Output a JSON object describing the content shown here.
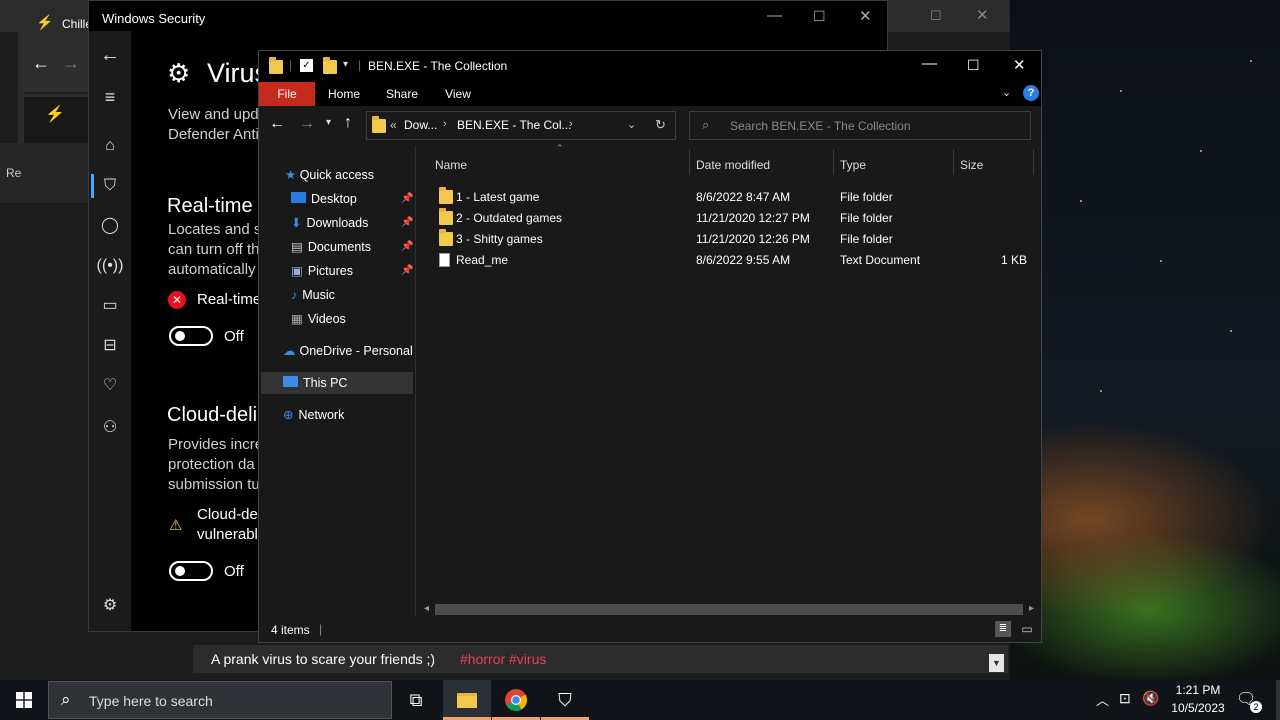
{
  "back_window": {
    "title": "Chille",
    "side_label": "Re"
  },
  "windows_security": {
    "title": "Windows Security",
    "page_title": "Virus",
    "intro_line1": "View and upd",
    "intro_line2": "Defender Anti",
    "realtime": {
      "heading": "Real-time",
      "desc1": "Locates and s",
      "desc2": "can turn off th",
      "desc3": "automatically",
      "warning": "Real-time",
      "toggle_label": "Off"
    },
    "cloud": {
      "heading": "Cloud-deli",
      "desc1": "Provides incre",
      "desc2": "protection da",
      "desc3": "submission tu",
      "warning1": "Cloud-de",
      "warning2": "vulnerabl",
      "toggle_label": "Off"
    }
  },
  "explorer": {
    "title": "BEN.EXE - The Collection",
    "ribbon": {
      "tabs": [
        "File",
        "Home",
        "Share",
        "View"
      ],
      "active_color": "#c42b1c"
    },
    "address": {
      "crumb1": "Dow...",
      "crumb2": "BEN.EXE - The Col...",
      "overflow": "«"
    },
    "search": {
      "placeholder": "Search BEN.EXE - The Collection"
    },
    "nav_pane": {
      "quick_access": "Quick access",
      "items": [
        "Desktop",
        "Downloads",
        "Documents",
        "Pictures",
        "Music",
        "Videos"
      ],
      "onedrive": "OneDrive - Personal",
      "this_pc": "This PC",
      "network": "Network"
    },
    "columns": {
      "name": "Name",
      "date": "Date modified",
      "type": "Type",
      "size": "Size"
    },
    "files": [
      {
        "name": "1 - Latest game",
        "date": "8/6/2022 8:47 AM",
        "type": "File folder",
        "size": "",
        "kind": "folder"
      },
      {
        "name": "2 - Outdated games",
        "date": "11/21/2020 12:27 PM",
        "type": "File folder",
        "size": "",
        "kind": "folder"
      },
      {
        "name": "3 - Shitty games",
        "date": "11/21/2020 12:26 PM",
        "type": "File folder",
        "size": "",
        "kind": "folder"
      },
      {
        "name": "Read_me",
        "date": "8/6/2022 9:55 AM",
        "type": "Text Document",
        "size": "1 KB",
        "kind": "text"
      }
    ],
    "status": {
      "count": "4 items"
    }
  },
  "caption": {
    "text": "A prank virus to scare your friends ;)",
    "tags": "#horror #virus",
    "tag_color": "#e8425a"
  },
  "taskbar": {
    "search_placeholder": "Type here to search",
    "time": "1:21 PM",
    "date": "10/5/2023",
    "notifications": "2"
  }
}
